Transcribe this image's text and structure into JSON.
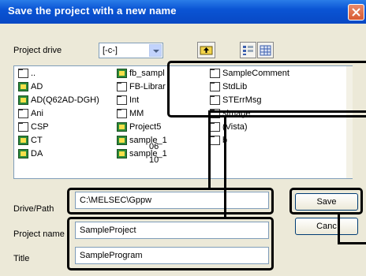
{
  "window": {
    "title": "Save the project with a new name"
  },
  "project_drive": {
    "label": "Project drive",
    "value": "[-c-]"
  },
  "toolbar": {
    "up_icon": "folder-up-icon",
    "list_view_icon": "list-view-icon",
    "detail_view_icon": "detail-view-icon"
  },
  "list": {
    "items": [
      {
        "type": "folder",
        "label": ".."
      },
      {
        "type": "project",
        "label": "AD"
      },
      {
        "type": "project",
        "label": "AD(Q62AD-DGH)"
      },
      {
        "type": "folder",
        "label": "Ani"
      },
      {
        "type": "folder",
        "label": "CSP"
      },
      {
        "type": "project",
        "label": "CT"
      },
      {
        "type": "project",
        "label": "DA"
      },
      {
        "type": "project",
        "label": "fb_sampl"
      },
      {
        "type": "folder",
        "label": "FB-Librar"
      },
      {
        "type": "folder",
        "label": "Int"
      },
      {
        "type": "folder",
        "label": "MM"
      },
      {
        "type": "project",
        "label": "Project5"
      },
      {
        "type": "project",
        "label": "sample_1"
      },
      {
        "type": "project",
        "label": "sample_1"
      },
      {
        "type": "folder",
        "label": "SampleComment"
      },
      {
        "type": "folder",
        "label": "StdLib"
      },
      {
        "type": "folder",
        "label": "STErrMsg"
      },
      {
        "type": "folder",
        "label": "simage"
      },
      {
        "type": "folder",
        "label": "(Vista)"
      },
      {
        "type": "folder",
        "label": "b"
      }
    ],
    "fragments": [
      "06",
      "10"
    ]
  },
  "drive_path": {
    "label": "Drive/Path",
    "value": "C:\\MELSEC\\Gppw"
  },
  "project_name": {
    "label": "Project name",
    "value": "SampleProject"
  },
  "title_field": {
    "label": "Title",
    "value": "SampleProgram"
  },
  "buttons": {
    "save": "Save",
    "cancel": "Canc"
  }
}
